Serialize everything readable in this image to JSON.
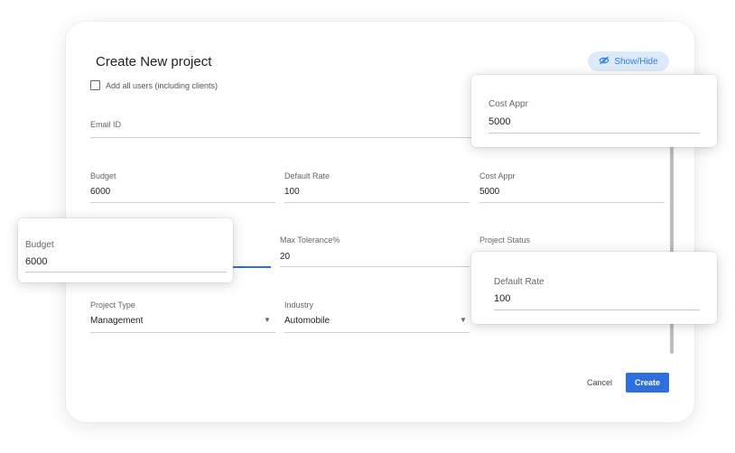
{
  "dialog": {
    "title": "Create New project",
    "show_hide_label": "Show/Hide",
    "checkbox_label": "Add all users (including clients)",
    "email": {
      "label": "Email ID",
      "value": ""
    },
    "budget": {
      "label": "Budget",
      "value": "6000"
    },
    "default_rate": {
      "label": "Default Rate",
      "value": "100"
    },
    "cost_appr": {
      "label": "Cost Appr",
      "value": "5000"
    },
    "max_tolerance": {
      "label": "Max Tolerance%",
      "value": "20"
    },
    "project_status": {
      "label": "Project Status",
      "value": ""
    },
    "project_type": {
      "label": "Project Type",
      "value": "Management"
    },
    "industry": {
      "label": "Industry",
      "value": "Automobile"
    },
    "cancel_label": "Cancel",
    "create_label": "Create"
  },
  "popups": {
    "cost_appr": {
      "label": "Cost Appr",
      "value": "5000"
    },
    "budget": {
      "label": "Budget",
      "value": "6000"
    },
    "default_rate": {
      "label": "Default Rate",
      "value": "100"
    }
  },
  "colors": {
    "accent": "#2f6ee0",
    "chip_bg": "#dcebfa"
  },
  "icons": {
    "show_hide": "eye-off-icon",
    "dropdown": "triangle-down-icon"
  }
}
